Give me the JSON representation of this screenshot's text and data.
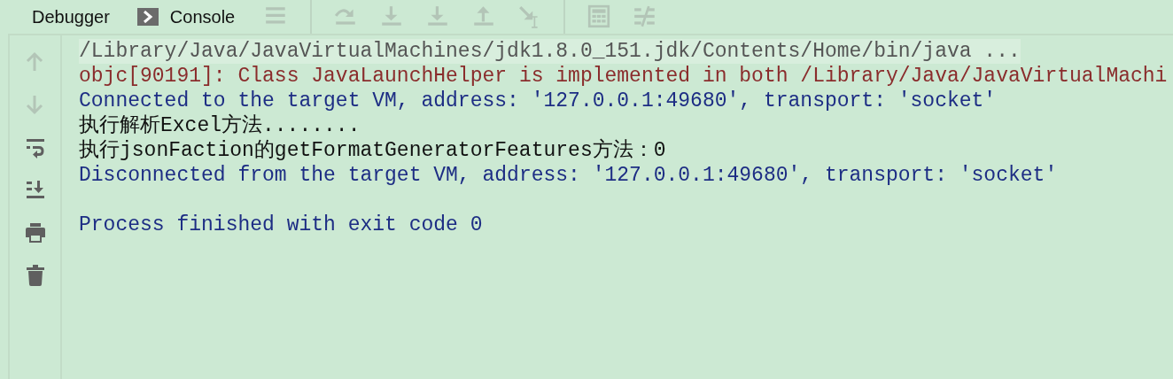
{
  "tabs": [
    {
      "label": "Debugger",
      "kind": "plain"
    },
    {
      "label": "Console",
      "kind": "console"
    }
  ],
  "toolbar": [
    {
      "disabled": true
    },
    {
      "disabled": true
    },
    {
      "disabled": true
    },
    {
      "disabled": true
    },
    {
      "disabled": true
    },
    {
      "disabled": true
    },
    {
      "disabled": true
    },
    {
      "disabled": true
    }
  ],
  "gutter": [
    {
      "disabled": true
    },
    {
      "disabled": true
    },
    {
      "disabled": false
    },
    {
      "disabled": false
    },
    {
      "disabled": false
    },
    {
      "disabled": false
    }
  ],
  "console": [
    {
      "kind": "command",
      "text": "/Library/Java/JavaVirtualMachines/jdk1.8.0_151.jdk/Contents/Home/bin/java ..."
    },
    {
      "kind": "error",
      "text": "objc[90191]: Class JavaLaunchHelper is implemented in both /Library/Java/JavaVirtualMachi"
    },
    {
      "kind": "system",
      "text": "Connected to the target VM, address: '127.0.0.1:49680', transport: 'socket'"
    },
    {
      "kind": "output",
      "text": "执行解析Excel方法........"
    },
    {
      "kind": "output",
      "text": "执行jsonFaction的getFormatGeneratorFeatures方法：0"
    },
    {
      "kind": "system",
      "text": "Disconnected from the target VM, address: '127.0.0.1:49680', transport: 'socket'"
    },
    {
      "kind": "exit",
      "text": "Process finished with exit code 0"
    }
  ]
}
